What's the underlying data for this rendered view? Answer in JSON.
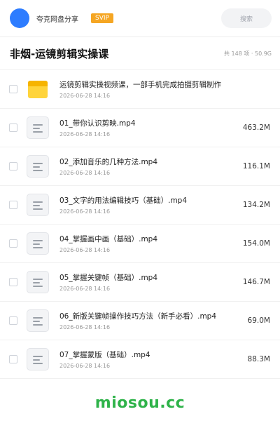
{
  "header": {
    "app_name": "夸克网盘分享",
    "badge": "SVIP",
    "search_placeholder": "搜索"
  },
  "share": {
    "title": "非烟-运镜剪辑实操课",
    "summary": "共 148 项 · 50.9G"
  },
  "items": [
    {
      "type": "folder",
      "name": "运镜剪辑实操视频课，一部手机完成拍摄剪辑制作",
      "date": "2026-06-28 14:16",
      "size": ""
    },
    {
      "type": "file",
      "name": "01_带你认识剪映.mp4",
      "date": "2026-06-28 14:16",
      "size": "463.2M"
    },
    {
      "type": "file",
      "name": "02_添加音乐的几种方法.mp4",
      "date": "2026-06-28 14:16",
      "size": "116.1M"
    },
    {
      "type": "file",
      "name": "03_文字的用法编辑技巧（基础）.mp4",
      "date": "2026-06-28 14:16",
      "size": "134.2M"
    },
    {
      "type": "file",
      "name": "04_掌握画中画（基础）.mp4",
      "date": "2026-06-28 14:16",
      "size": "154.0M"
    },
    {
      "type": "file",
      "name": "05_掌握关键帧（基础）.mp4",
      "date": "2026-06-28 14:16",
      "size": "146.7M"
    },
    {
      "type": "file",
      "name": "06_新版关键帧操作技巧方法（新手必看）.mp4",
      "date": "2026-06-28 14:16",
      "size": "69.0M"
    },
    {
      "type": "file",
      "name": "07_掌握蒙版（基础）.mp4",
      "date": "2026-06-28 14:16",
      "size": "88.3M"
    }
  ],
  "icons": {
    "folder": "folder-icon",
    "file": "video-file-icon"
  },
  "colors": {
    "accent": "#2d7cff",
    "svip": "#f5a623",
    "folder": "#ffd43b",
    "watermark": "#2fb34a"
  },
  "watermark": "miosou.cc"
}
